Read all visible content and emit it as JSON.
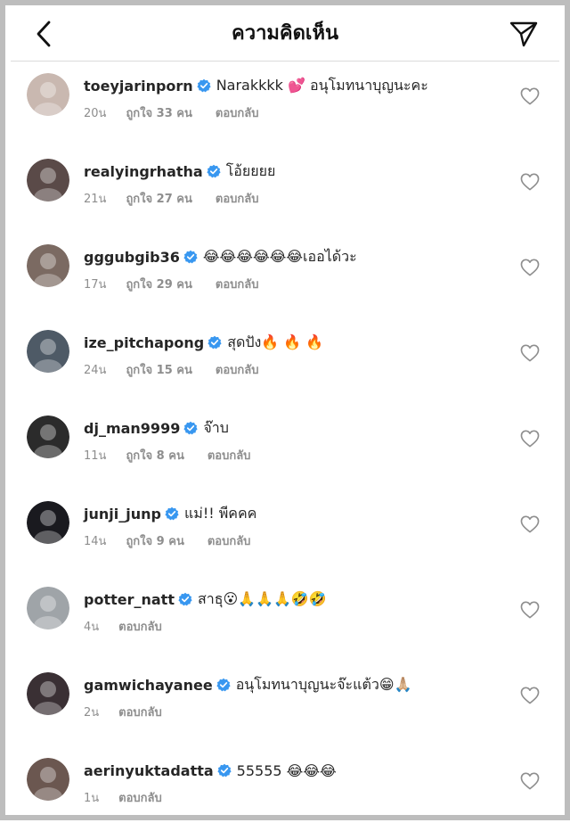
{
  "header": {
    "title": "ความคิดเห็น"
  },
  "comments": [
    {
      "username": "toeyjarinporn",
      "text": "Narakkkk 💕 อนุโมทนาบุญนะคะ",
      "time": "20น",
      "likes": "ถูกใจ 33 คน",
      "reply": "ตอบกลับ",
      "avatar_color": "#c9b8b0"
    },
    {
      "username": "realyingrhatha",
      "text": "โอ้ยยยย",
      "time": "21น",
      "likes": "ถูกใจ 27 คน",
      "reply": "ตอบกลับ",
      "avatar_color": "#5a4a48"
    },
    {
      "username": "gggubgib36",
      "text": "😂😂😂😂😂😂เออได้วะ",
      "time": "17น",
      "likes": "ถูกใจ 29 คน",
      "reply": "ตอบกลับ",
      "avatar_color": "#7b6a62"
    },
    {
      "username": "ize_pitchapong",
      "text": "สุดปัง🔥 🔥 🔥",
      "time": "24น",
      "likes": "ถูกใจ 15 คน",
      "reply": "ตอบกลับ",
      "avatar_color": "#4e5a66"
    },
    {
      "username": "dj_man9999",
      "text": "จ๊าบ",
      "time": "11น",
      "likes": "ถูกใจ 8 คน",
      "reply": "ตอบกลับ",
      "avatar_color": "#2b2b2b"
    },
    {
      "username": "junji_junp",
      "text": "แม่!! พีคคค",
      "time": "14น",
      "likes": "ถูกใจ 9 คน",
      "reply": "ตอบกลับ",
      "avatar_color": "#1a1a1f"
    },
    {
      "username": "potter_natt",
      "text": "สาธุ😮🙏🙏🙏🤣🤣",
      "time": "4น",
      "likes": "",
      "reply": "ตอบกลับ",
      "avatar_color": "#9fa4a8"
    },
    {
      "username": "gamwichayanee",
      "text": "อนุโมทนาบุญนะจ๊ะแต้ว😁🙏🏼",
      "time": "2น",
      "likes": "",
      "reply": "ตอบกลับ",
      "avatar_color": "#3a3034"
    },
    {
      "username": "aerinyuktadatta",
      "text": "55555 😂😂😂",
      "time": "1น",
      "likes": "",
      "reply": "ตอบกลับ",
      "avatar_color": "#6b5750"
    }
  ],
  "colors": {
    "verified": "#3897f0",
    "muted": "#8e8e8e",
    "text": "#262626"
  },
  "icons": {
    "back": "chevron-left-icon",
    "send": "paper-plane-icon",
    "like": "heart-outline-icon",
    "verified": "verified-badge-icon"
  }
}
